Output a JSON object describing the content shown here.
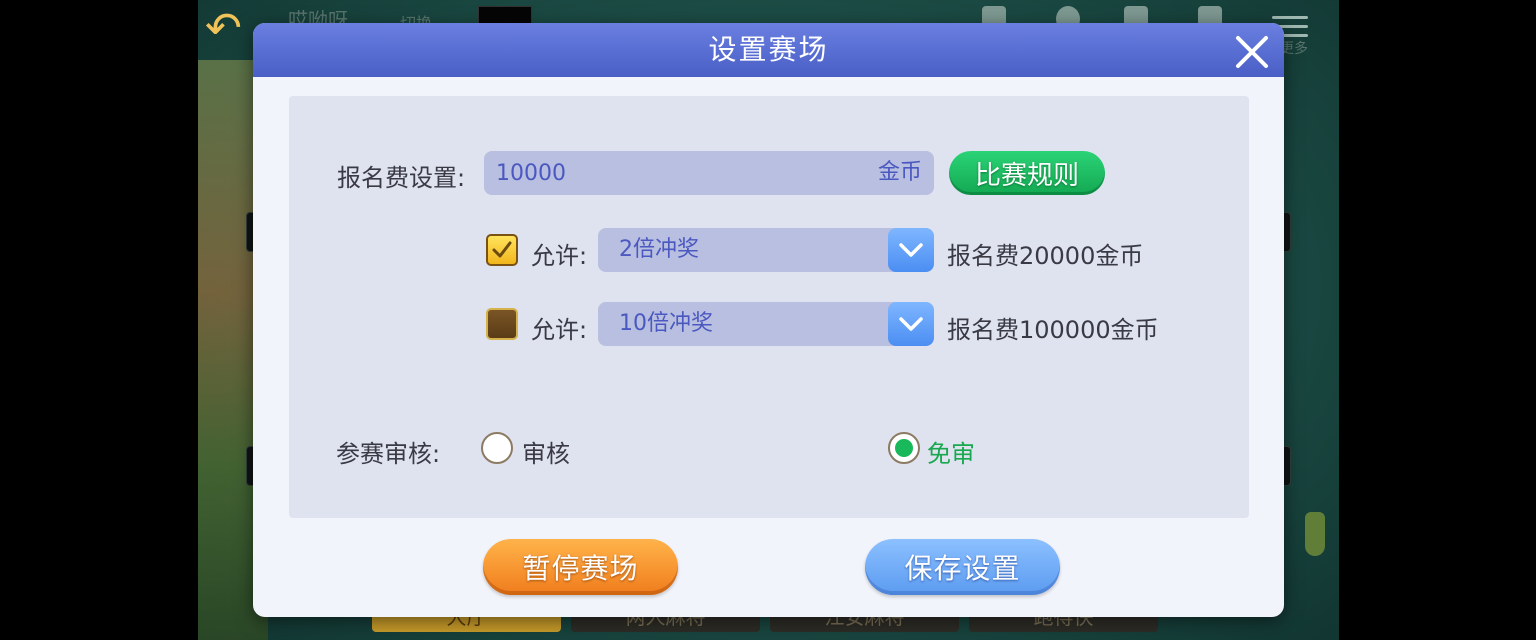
{
  "background": {
    "top_bar": {
      "title": "哎呦呀",
      "switch_label": "切换",
      "more_label": "更多"
    },
    "bottom_tabs": [
      {
        "label": "大厅",
        "active": true
      },
      {
        "label": "两人麻将",
        "active": false
      },
      {
        "label": "江安麻将",
        "active": false
      },
      {
        "label": "跑得快",
        "active": false
      }
    ]
  },
  "dialog": {
    "title": "设置赛场",
    "entry_fee": {
      "label": "报名费设置:",
      "value": "10000",
      "unit": "金币",
      "rules_button": "比赛规则"
    },
    "multipliers": [
      {
        "checked": true,
        "allow_label": "允许:",
        "option": "2倍冲奖",
        "fee_text": "报名费20000金币"
      },
      {
        "checked": false,
        "allow_label": "允许:",
        "option": "10倍冲奖",
        "fee_text": "报名费100000金币"
      }
    ],
    "review": {
      "label": "参赛审核:",
      "options": [
        {
          "label": "审核",
          "selected": false
        },
        {
          "label": "免审",
          "selected": true
        }
      ]
    },
    "buttons": {
      "pause": "暂停赛场",
      "save": "保存设置"
    }
  },
  "colors": {
    "header": "#5468d4",
    "panel": "#dfe2ef",
    "input_bg": "#b9bfe0",
    "input_text": "#4a58c0",
    "green": "#19b85a",
    "orange": "#f28a26",
    "blue": "#6aa6f6"
  },
  "icons": {
    "close": "close-icon",
    "check": "checkmark-icon",
    "dropdown": "chevron-down-icon",
    "back": "back-arrow-icon",
    "menu": "menu-icon"
  }
}
